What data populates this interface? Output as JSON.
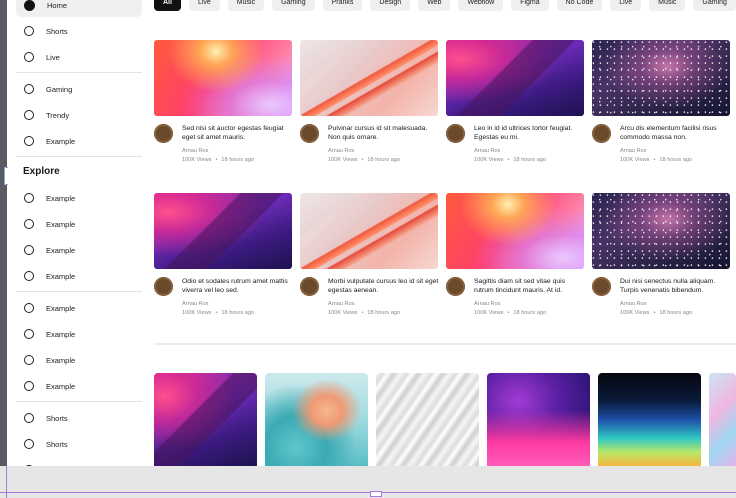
{
  "sidebar": {
    "top_items": [
      {
        "label": "Home",
        "active": true
      },
      {
        "label": "Shorts"
      },
      {
        "label": "Live"
      },
      {
        "label": "Gaming"
      },
      {
        "label": "Trendy"
      },
      {
        "label": "Example"
      }
    ],
    "explore_heading": "Explore",
    "explore_items": [
      {
        "label": "Example"
      },
      {
        "label": "Example"
      },
      {
        "label": "Example"
      },
      {
        "label": "Example"
      },
      {
        "label": "Example"
      },
      {
        "label": "Example"
      },
      {
        "label": "Example"
      },
      {
        "label": "Example"
      },
      {
        "label": "Shorts"
      },
      {
        "label": "Shorts"
      }
    ]
  },
  "chips": [
    "All",
    "Live",
    "Music",
    "Gaming",
    "Pranks",
    "Design",
    "Web",
    "Webflow",
    "Figma",
    "No Code",
    "Live",
    "Music",
    "Gaming"
  ],
  "videos": [
    {
      "title": "Sed nisi sit auctor egestas feugiat eget sit amet mauris.",
      "author": "Arnau Ros",
      "views": "100K Views",
      "time": "18 hours ago",
      "thumb": "fire"
    },
    {
      "title": "Pulvinar cursus id sit malesuada. Non quis ornare.",
      "author": "Arnau Ros",
      "views": "100K Views",
      "time": "18 hours ago",
      "thumb": "wave"
    },
    {
      "title": "Leo in id id ultrices tortor feugiat. Egestas eu mi.",
      "author": "Arnau Ros",
      "views": "100K Views",
      "time": "18 hours ago",
      "thumb": "cosmic"
    },
    {
      "title": "Arcu dis elementum facilisi risus commodo massa non.",
      "author": "Arnau Ros",
      "views": "100K Views",
      "time": "18 hours ago",
      "thumb": "galaxy"
    },
    {
      "title": "Odio et sodales rutrum amet mattis viverra vel leo sed.",
      "author": "Arnau Ros",
      "views": "100K Views",
      "time": "18 hours ago",
      "thumb": "cosmic"
    },
    {
      "title": "Morbi vulputate cursus leo id sit eget egestas aenean.",
      "author": "Arnau Ros",
      "views": "100K Views",
      "time": "18 hours ago",
      "thumb": "wave"
    },
    {
      "title": "Sagittis diam sit sed vitae quis rutrum tincidunt mauris. At id.",
      "author": "Arnau Ros",
      "views": "100K Views",
      "time": "18 hours ago",
      "thumb": "fire"
    },
    {
      "title": "Dui nisi senectus nulla aliquam. Turpis venenatis bibendum.",
      "author": "Arnau Ros",
      "views": "100K Views",
      "time": "18 hours ago",
      "thumb": "galaxy"
    }
  ],
  "shorts": [
    {
      "thumb": "cosmic"
    },
    {
      "thumb": "teal"
    },
    {
      "thumb": "white"
    },
    {
      "thumb": "pink"
    },
    {
      "thumb": "aurora"
    },
    {
      "thumb": "marble"
    }
  ]
}
